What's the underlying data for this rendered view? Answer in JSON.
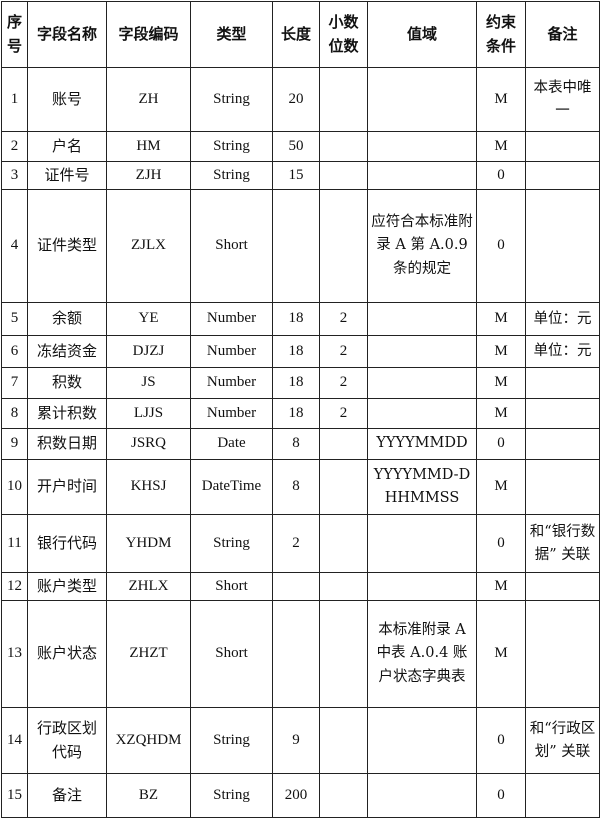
{
  "table": {
    "headers": [
      "序号",
      "字段名称",
      "字段编码",
      "类型",
      "长度",
      "小数位数",
      "值域",
      "约束条件",
      "备注"
    ],
    "rows": [
      [
        "1",
        "账号",
        "ZH",
        "String",
        "20",
        "",
        "",
        "M",
        "本表中唯一"
      ],
      [
        "2",
        "户名",
        "HM",
        "String",
        "50",
        "",
        "",
        "M",
        ""
      ],
      [
        "3",
        "证件号",
        "ZJH",
        "String",
        "15",
        "",
        "",
        "0",
        ""
      ],
      [
        "4",
        "证件类型",
        "ZJLX",
        "Short",
        "",
        "",
        "应符合本标准附录 A 第 A.0.9 条的规定",
        "0",
        ""
      ],
      [
        "5",
        "余额",
        "YE",
        "Number",
        "18",
        "2",
        "",
        "M",
        "单位：元"
      ],
      [
        "6",
        "冻结资金",
        "DJZJ",
        "Number",
        "18",
        "2",
        "",
        "M",
        "单位：元"
      ],
      [
        "7",
        "积数",
        "JS",
        "Number",
        "18",
        "2",
        "",
        "M",
        ""
      ],
      [
        "8",
        "累计积数",
        "LJJS",
        "Number",
        "18",
        "2",
        "",
        "M",
        ""
      ],
      [
        "9",
        "积数日期",
        "JSRQ",
        "Date",
        "8",
        "",
        "YYYYMMDD",
        "0",
        ""
      ],
      [
        "10",
        "开户时间",
        "KHSJ",
        "DateTime",
        "8",
        "",
        "YYYYMMD-DHHMMSS",
        "M",
        ""
      ],
      [
        "11",
        "银行代码",
        "YHDM",
        "String",
        "2",
        "",
        "",
        "0",
        "和“银行数据” 关联"
      ],
      [
        "12",
        "账户类型",
        "ZHLX",
        "Short",
        "",
        "",
        "",
        "M",
        ""
      ],
      [
        "13",
        "账户状态",
        "ZHZT",
        "Short",
        "",
        "",
        "本标准附录 A 中表 A.0.4 账户状态字典表",
        "M",
        ""
      ],
      [
        "14",
        "行政区划代码",
        "XZQHDM",
        "String",
        "9",
        "",
        "",
        "0",
        "和“行政区划” 关联"
      ],
      [
        "15",
        "备注",
        "BZ",
        "String",
        "200",
        "",
        "",
        "0",
        ""
      ]
    ]
  }
}
